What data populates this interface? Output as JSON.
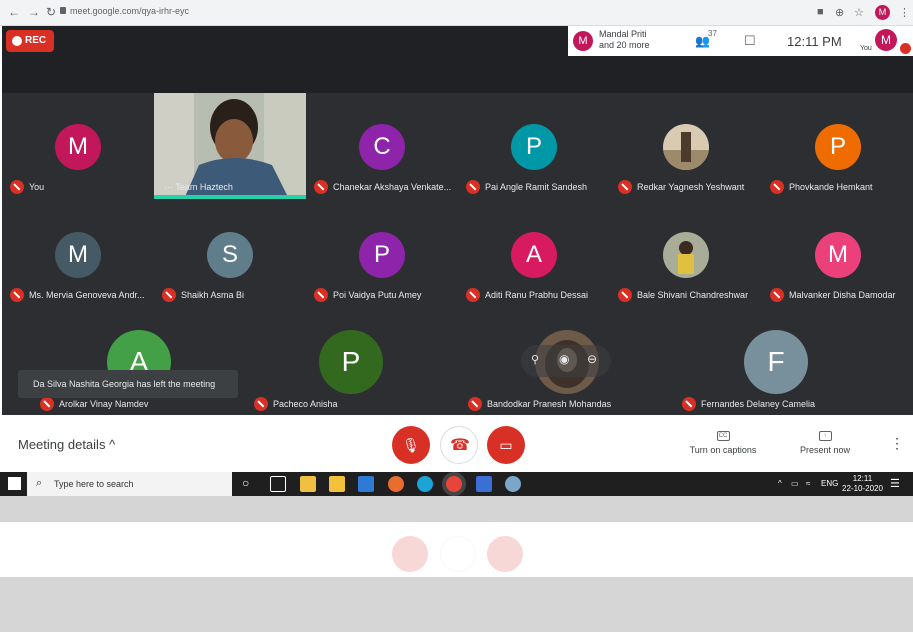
{
  "browser": {
    "url": "meet.google.com/qya-irhr-eyc",
    "profile_initial": "M"
  },
  "rec_label": "REC",
  "header": {
    "presenter_initial": "M",
    "presenter_name": "Mandal Priti",
    "presenter_more": "and 20 more",
    "people_count": "37",
    "time": "12:11 PM",
    "you_label": "You",
    "you_initial": "M"
  },
  "tiles": [
    {
      "name": "You",
      "initial": "M",
      "color": "#c2185b"
    },
    {
      "name": "Team Haztech",
      "initial": "",
      "color": ""
    },
    {
      "name": "Chanekar Akshaya Venkate...",
      "initial": "C",
      "color": "#8e24aa"
    },
    {
      "name": "Pai Angle Ramit Sandesh",
      "initial": "P",
      "color": "#0097a7"
    },
    {
      "name": "Redkar Yagnesh Yeshwant",
      "initial": "",
      "color": "#b0a48a"
    },
    {
      "name": "Phovkande Hemkant",
      "initial": "P",
      "color": "#ef6c00"
    },
    {
      "name": "Ms. Mervia Genoveva Andr...",
      "initial": "M",
      "color": "#455a64"
    },
    {
      "name": "Shaikh Asma Bi",
      "initial": "S",
      "color": "#607d8b"
    },
    {
      "name": "Poi Vaidya Putu Amey",
      "initial": "P",
      "color": "#8e24aa"
    },
    {
      "name": "Aditi Ranu Prabhu Dessai",
      "initial": "A",
      "color": "#d81b60"
    },
    {
      "name": "Bale Shivani Chandreshwar",
      "initial": "",
      "color": "#8a9078"
    },
    {
      "name": "Malvanker Disha Damodar",
      "initial": "M",
      "color": "#ec407a"
    },
    {
      "name": "Arolkar Vinay Namdev",
      "initial": "A",
      "color": "#43a047"
    },
    {
      "name": "Pacheco Anisha",
      "initial": "P",
      "color": "#33691e"
    },
    {
      "name": "Bandodkar Pranesh Mohandas",
      "initial": "",
      "color": "#5d4c3c"
    },
    {
      "name": "Fernandes Delaney Camelia",
      "initial": "F",
      "color": "#78909c"
    }
  ],
  "toast": "Da Silva Nashita Georgia has left the meeting",
  "bottom": {
    "meeting_details": "Meeting details",
    "captions_label": "Turn on captions",
    "captions_icon": "CC",
    "present_label": "Present now"
  },
  "taskbar": {
    "search_placeholder": "Type here to search",
    "lang": "ENG",
    "time": "12:11",
    "date": "22-10-2020"
  }
}
